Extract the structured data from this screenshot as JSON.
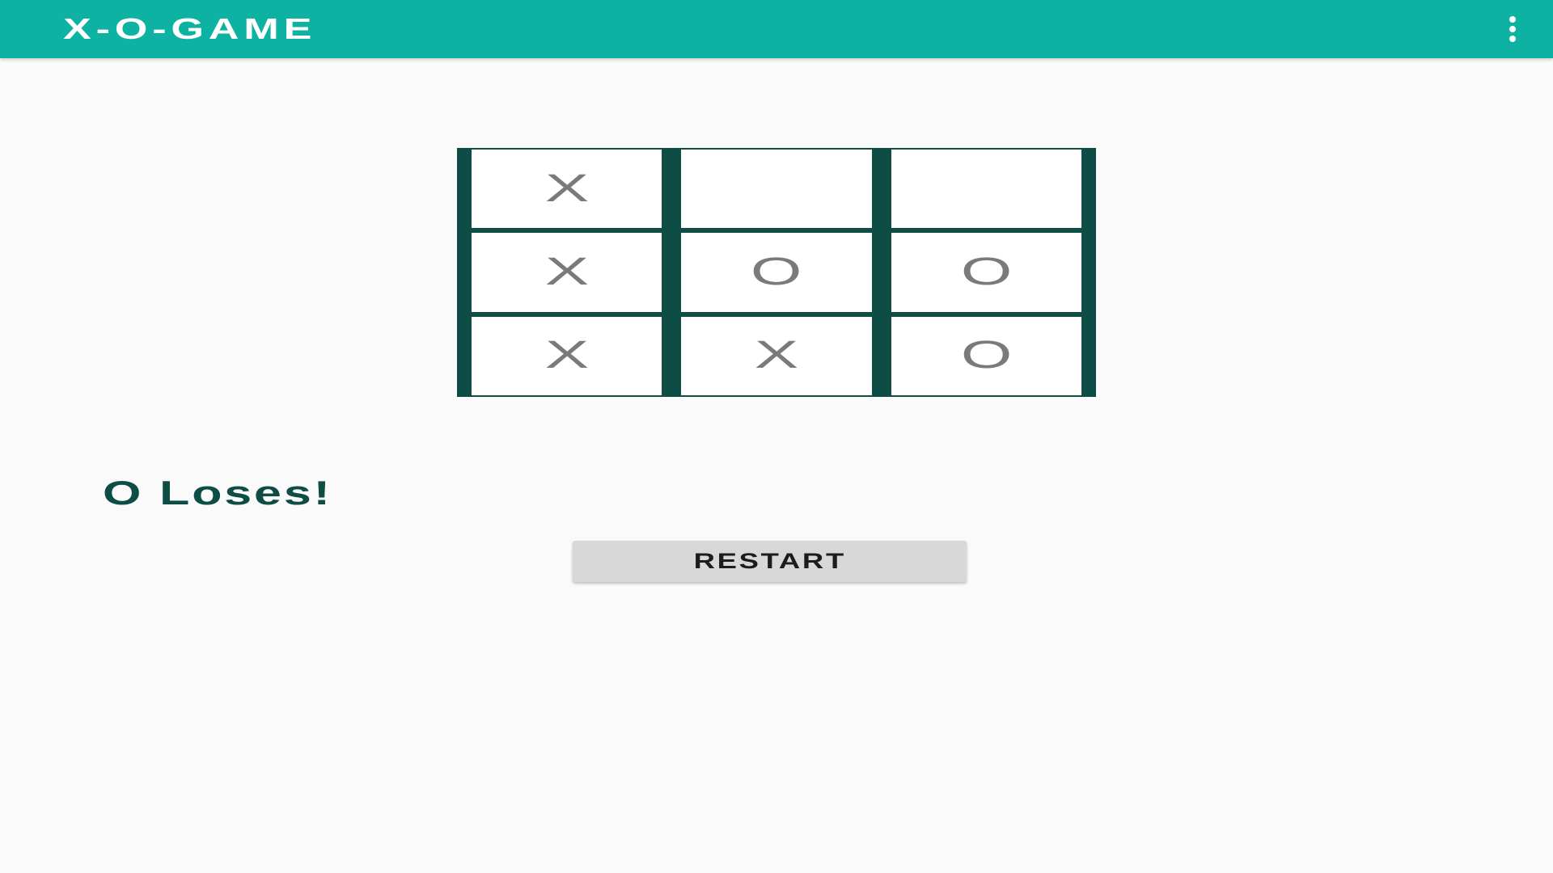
{
  "app_bar": {
    "title": "X-O-GAME",
    "menu_icon": "more-vertical-icon",
    "background_color": "#0eb2a3"
  },
  "board": {
    "grid_color": "#0d4d46",
    "cells": [
      [
        "X",
        "",
        ""
      ],
      [
        "X",
        "O",
        "O"
      ],
      [
        "X",
        "X",
        "O"
      ]
    ]
  },
  "status": {
    "text": "O Loses!",
    "color": "#0d4d46"
  },
  "restart_button": {
    "label": "RESTART"
  }
}
